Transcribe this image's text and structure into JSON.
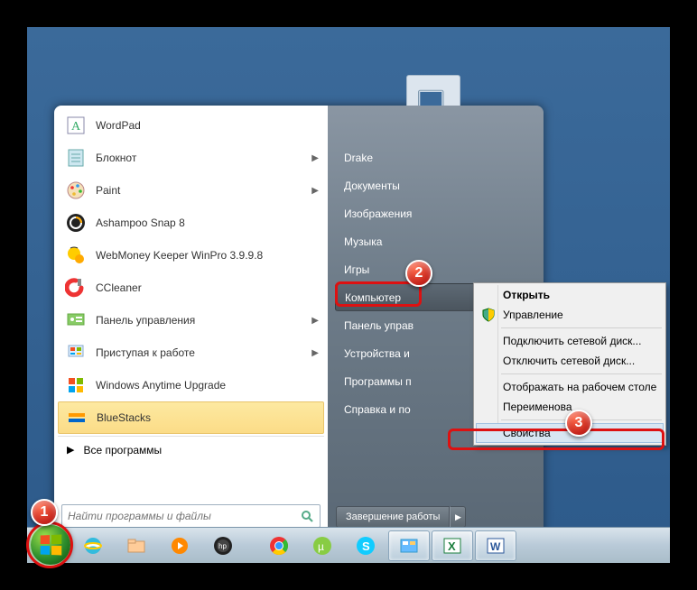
{
  "markers": {
    "m1": "1",
    "m2": "2",
    "m3": "3"
  },
  "apps": {
    "a0": "WordPad",
    "a1": "Блокнот",
    "a2": "Paint",
    "a3": "Ashampoo Snap 8",
    "a4": "WebMoney Keeper WinPro 3.9.9.8",
    "a5": "CCleaner",
    "a6": "Панель управления",
    "a7": "Приступая к работе",
    "a8": "Windows Anytime Upgrade",
    "a9": "BlueStacks"
  },
  "all_programs": "Все программы",
  "search": {
    "placeholder": "Найти программы и файлы"
  },
  "right": {
    "r0": "Drake",
    "r1": "Документы",
    "r2": "Изображения",
    "r3": "Музыка",
    "r4": "Игры",
    "r5": "Компьютер",
    "r6": "Панель управ",
    "r7": "Устройства и ",
    "r8": "Программы п",
    "r9": "Справка и по"
  },
  "shutdown_label": "Завершение работы",
  "ctx": {
    "c0": "Открыть",
    "c1": "Управление",
    "c2": "Подключить сетевой диск...",
    "c3": "Отключить сетевой диск...",
    "c4": "Отображать на рабочем столе",
    "c5": "Переименова",
    "c6": "Свойства"
  },
  "icons": {
    "wordpad": "wordpad-icon",
    "notepad": "notepad-icon",
    "paint": "paint-icon",
    "ashampoo": "ashampoo-icon",
    "webmoney": "webmoney-icon",
    "ccleaner": "ccleaner-icon",
    "control": "control-panel-icon",
    "getstarted": "getstarted-icon",
    "anytime": "anytime-icon",
    "bluestacks": "bluestacks-icon",
    "shield": "shield-icon",
    "ie": "ie-icon",
    "explorer": "explorer-icon",
    "wmp": "wmp-icon",
    "hp": "hp-icon",
    "chrome": "chrome-icon",
    "torrent": "torrent-icon",
    "skype": "skype-icon",
    "tile": "tile-icon",
    "excel": "excel-icon",
    "word": "word-icon"
  },
  "colors": {
    "marker": "#d11",
    "accent": "#3b6a9a"
  }
}
